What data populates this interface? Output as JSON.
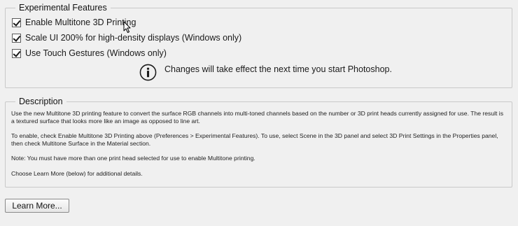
{
  "experimental": {
    "title": "Experimental Features",
    "options": [
      {
        "label": "Enable Multitone 3D Printing",
        "checked": true
      },
      {
        "label": "Scale UI 200% for high-density displays (Windows only)",
        "checked": true
      },
      {
        "label": "Use Touch Gestures (Windows only)",
        "checked": true
      }
    ],
    "info_icon": "info-circle-icon",
    "info_text": "Changes will take effect the next time you start Photoshop."
  },
  "description": {
    "title": "Description",
    "paragraphs": [
      "Use the new Multitone 3D printing feature to convert the surface RGB channels into multi-toned channels based on the number or 3D print heads currently assigned for use. The result is a textured surface that looks more like an image as opposed to line art.",
      "To enable, check Enable Multitone 3D Printing above (Preferences > Experimental Features).  To use, select Scene in the 3D panel and select 3D Print Settings in the Properties panel, then check Multitone Surface in the Material section.",
      "Note: You must have more than one print head selected for use to enable Multitone printing.",
      "Choose Learn More (below) for additional details."
    ]
  },
  "learn_more_button": "Learn More..."
}
